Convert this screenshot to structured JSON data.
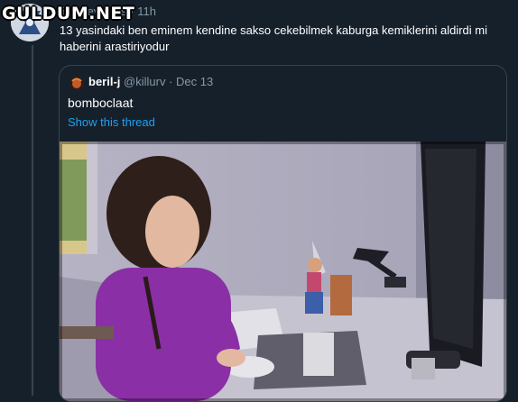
{
  "watermark": "GULDUM.NET",
  "tweet": {
    "handle": "@deleydikus",
    "separator": "·",
    "time": "11h",
    "text": "13 yasindaki ben eminem kendine sakso cekebilmek kaburga kemiklerini aldirdi mi haberini arastiriyodur"
  },
  "quote": {
    "name": "beril-j",
    "handle": "@killurv",
    "separator": "·",
    "date": "Dec 13",
    "text": "bomboclaat",
    "link_label": "Show this thread"
  },
  "colors": {
    "background": "#15202b",
    "border": "#38444d",
    "link": "#1da1f2",
    "secondary_text": "#8899a6"
  },
  "icons": [
    "avatar-image",
    "quote-avatar-image",
    "quoted-photo"
  ]
}
